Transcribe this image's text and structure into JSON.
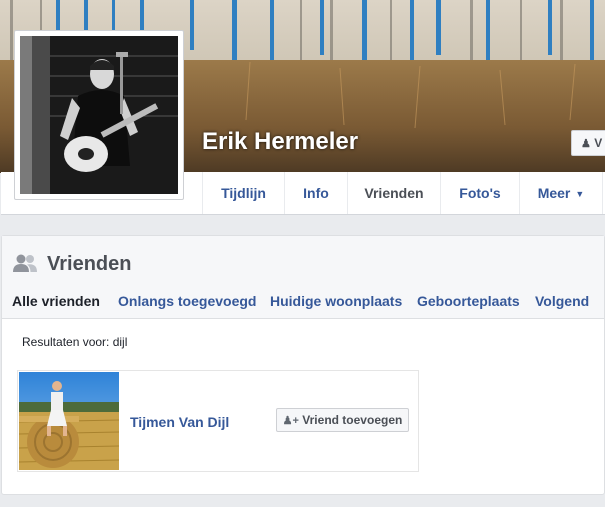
{
  "profile": {
    "name": "Erik Hermeler",
    "cover_button_label": "V"
  },
  "nav": {
    "tabs": [
      {
        "label": "Tijdlijn"
      },
      {
        "label": "Info"
      },
      {
        "label": "Vrienden"
      },
      {
        "label": "Foto's"
      },
      {
        "label": "Meer"
      }
    ],
    "active_tab": "Vrienden"
  },
  "friends_panel": {
    "title": "Vrienden",
    "icon": "friends-icon",
    "subtabs": [
      {
        "label": "Alle vrienden"
      },
      {
        "label": "Onlangs toegevoegd"
      },
      {
        "label": "Huidige woonplaats"
      },
      {
        "label": "Geboorteplaats"
      },
      {
        "label": "Volgend"
      }
    ],
    "active_subtab": "Alle vrienden",
    "results_label": "Resultaten voor: dijl",
    "results": [
      {
        "name": "Tijmen Van Dijl",
        "button_label": "Vriend toevoegen",
        "button_icon": "add-friend-icon"
      }
    ]
  },
  "colors": {
    "link": "#365899",
    "text": "#1d2129",
    "background": "#e9ebee"
  }
}
